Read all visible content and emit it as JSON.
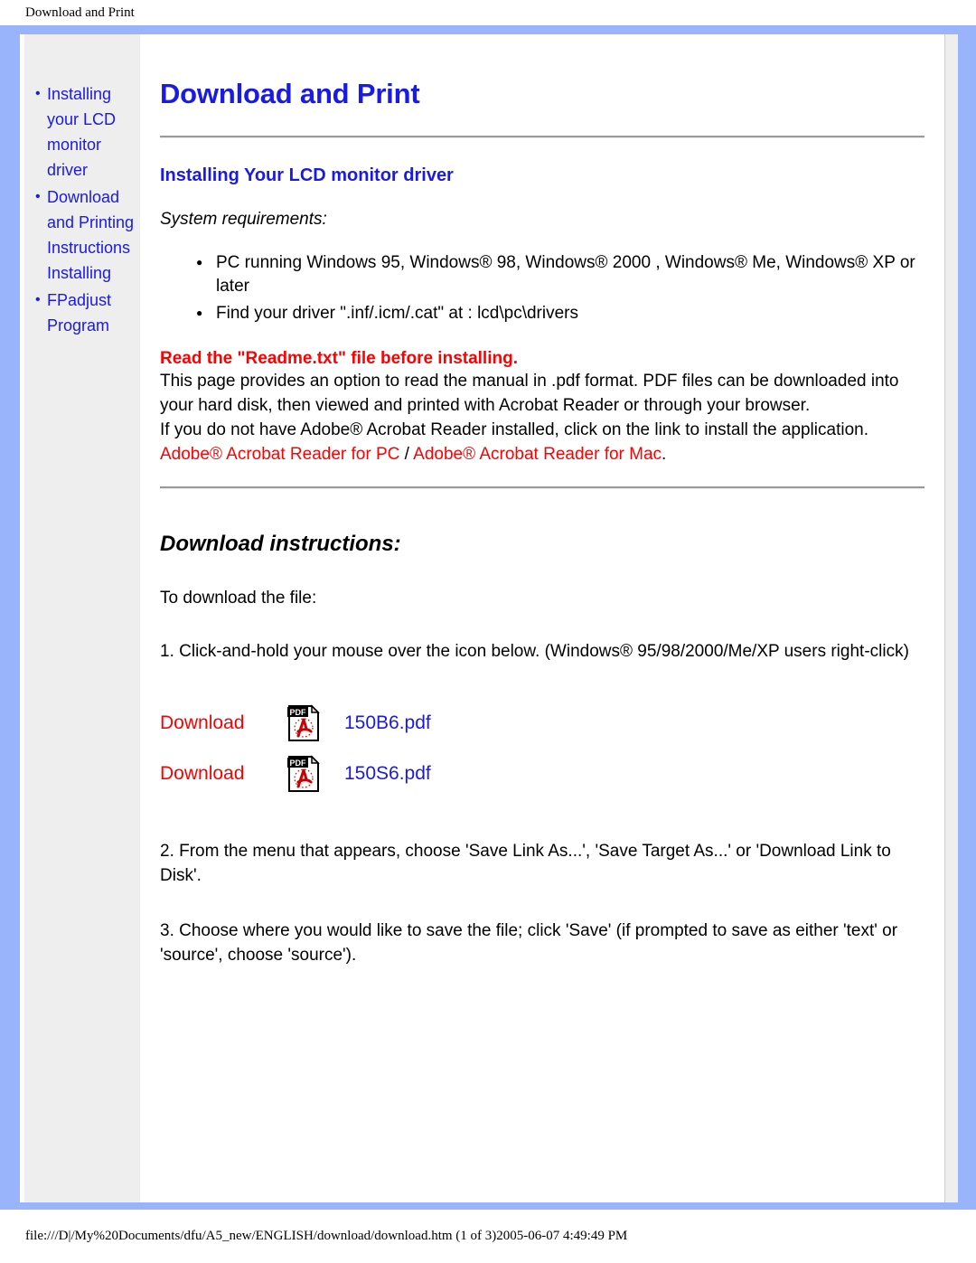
{
  "browser": {
    "header_title": "Download and Print",
    "footer_path": "file:///D|/My%20Documents/dfu/A5_new/ENGLISH/download/download.htm (1 of 3)2005-06-07 4:49:49 PM"
  },
  "colors": {
    "frame_blue": "#9ab4fb",
    "link_blue": "#1a1ae6",
    "link_red": "#ff0000",
    "sidebar_grey": "#eeeeee",
    "rule_grey": "#9a9a9a"
  },
  "sidebar": {
    "items": [
      {
        "label": "Installing your LCD monitor driver"
      },
      {
        "label": "Download and Printing Instructions"
      },
      {
        "label": "FPadjust Program"
      }
    ],
    "sub_items": [
      {
        "label": "Installing"
      }
    ]
  },
  "main": {
    "page_title": "Download and Print",
    "section_title": "Installing Your LCD monitor driver",
    "system_requirements_label": "System requirements:",
    "requirements": [
      "PC running Windows 95, Windows® 98, Windows® 2000 , Windows® Me, Windows® XP or later",
      "Find your driver \".inf/.icm/.cat\" at : lcd\\pc\\drivers"
    ],
    "warning": "Read the \"Readme.txt\" file before installing.",
    "intro_paragraph": "This page provides an option to read the manual in .pdf format. PDF files can be downloaded into your hard disk, then viewed and printed with Acrobat Reader or through your browser.",
    "acrobat_paragraph": "If you do not have Adobe® Acrobat Reader installed, click on the link to install the application.",
    "acrobat_link_pc": "Adobe® Acrobat Reader for PC",
    "acrobat_link_separator": " / ",
    "acrobat_link_mac": "Adobe® Acrobat Reader for Mac",
    "acrobat_link_end": ".",
    "download_instructions_title": "Download instructions:",
    "to_download_label": "To download the file:",
    "step_1": "1. Click-and-hold your mouse over the icon below. (Windows® 95/98/2000/Me/XP users right-click)",
    "step_2": "2. From the menu that appears, choose 'Save Link As...', 'Save Target As...' or 'Download Link to Disk'.",
    "step_3": "3. Choose where you would like to save the file; click 'Save' (if prompted to save as either 'text' or 'source', choose 'source').",
    "downloads": [
      {
        "action_label": "Download",
        "icon": "pdf-file-icon",
        "file_name": "150B6.pdf"
      },
      {
        "action_label": "Download",
        "icon": "pdf-file-icon",
        "file_name": "150S6.pdf"
      }
    ]
  }
}
